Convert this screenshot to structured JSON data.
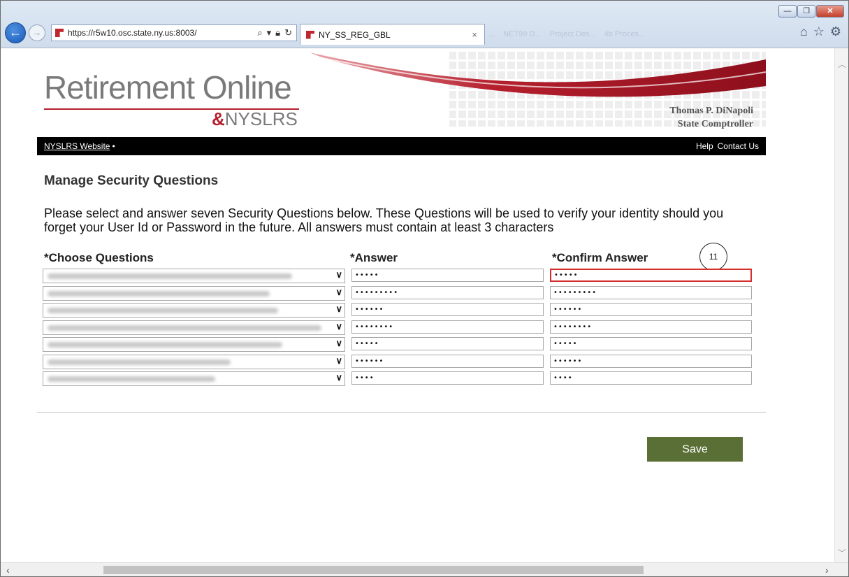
{
  "browser": {
    "address": "https://r5w10.osc.state.ny.us:8003/",
    "tab_title": "NY_SS_REG_GBL",
    "ghost_tabs": [
      "...",
      "NET99 D...",
      "Project Des...",
      "4b Proces..."
    ]
  },
  "banner": {
    "logo_title": "Retirement Online",
    "logo_sub": "NYSLRS",
    "comptroller_name": "Thomas P. DiNapoli",
    "comptroller_title": "State Comptroller",
    "accent": "#b51f2d"
  },
  "nav": {
    "website_link": "NYSLRS Website",
    "bullet": "•",
    "help": "Help",
    "contact": "Contact Us"
  },
  "page": {
    "title": "Manage Security Questions",
    "instructions": "Please select and answer seven Security Questions below. These Questions will be used to verify your identity should you forget your User Id or Password in the future. All answers must contain at least 3 characters"
  },
  "grid": {
    "col_questions": "*Choose Questions",
    "col_answer": "*Answer",
    "col_confirm": "*Confirm Answer",
    "callout_number": "11",
    "rows": [
      {
        "answer": "•••••",
        "confirm": "•••••"
      },
      {
        "answer": "•••••••••",
        "confirm": "•••••••••"
      },
      {
        "answer": "••••••",
        "confirm": "••••••"
      },
      {
        "answer": "••••••••",
        "confirm": "••••••••"
      },
      {
        "answer": "•••••",
        "confirm": "•••••"
      },
      {
        "answer": "••••••",
        "confirm": "••••••"
      },
      {
        "answer": "••••",
        "confirm": "••••"
      }
    ]
  },
  "actions": {
    "save_label": "Save",
    "save_color": "#5a6f35"
  }
}
